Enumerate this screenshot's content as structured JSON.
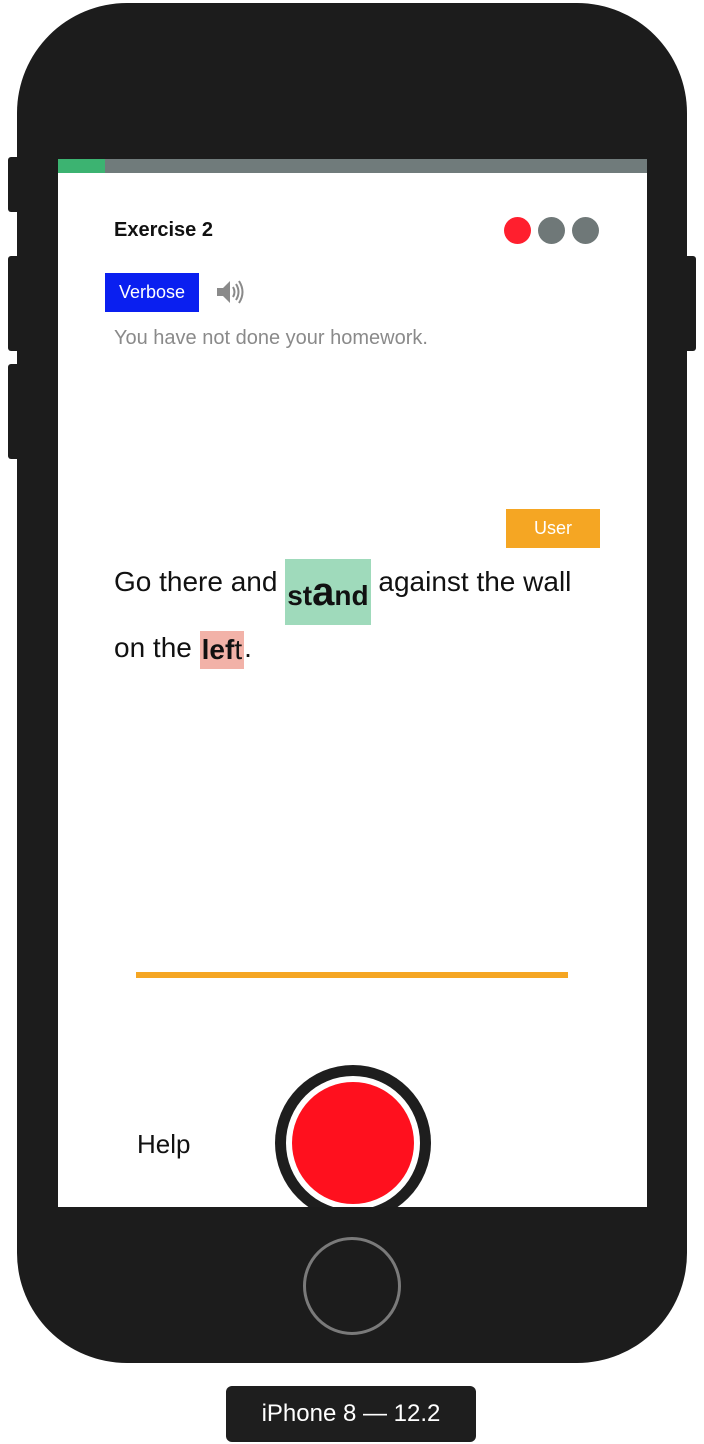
{
  "exercise": {
    "title": "Exercise 2",
    "progress": 0.08,
    "status_dots": [
      "#ff1f2e",
      "#6f7878",
      "#6f7878"
    ]
  },
  "controls": {
    "verbose_label": "Verbose",
    "speaker_icon": "speaker-icon",
    "user_label": "User",
    "help_label": "Help",
    "record_icon": "record-button"
  },
  "hint": "You have not done your homework.",
  "sentence": {
    "part1": "Go there and ",
    "highlight1_a": "st",
    "highlight1_b": "a",
    "highlight1_c": "nd",
    "part2": " against the wall on the ",
    "highlight2_a": "lef",
    "highlight2_b": "t",
    "part3": "."
  },
  "device_label": "iPhone 8 — 12.2",
  "colors": {
    "accent_orange": "#f5a623",
    "verbose_blue": "#0a1ff0",
    "record_red": "#ff101e",
    "correct_green": "#9fdabb",
    "error_red": "#f2b2a8",
    "progress_green": "#3cb371"
  }
}
